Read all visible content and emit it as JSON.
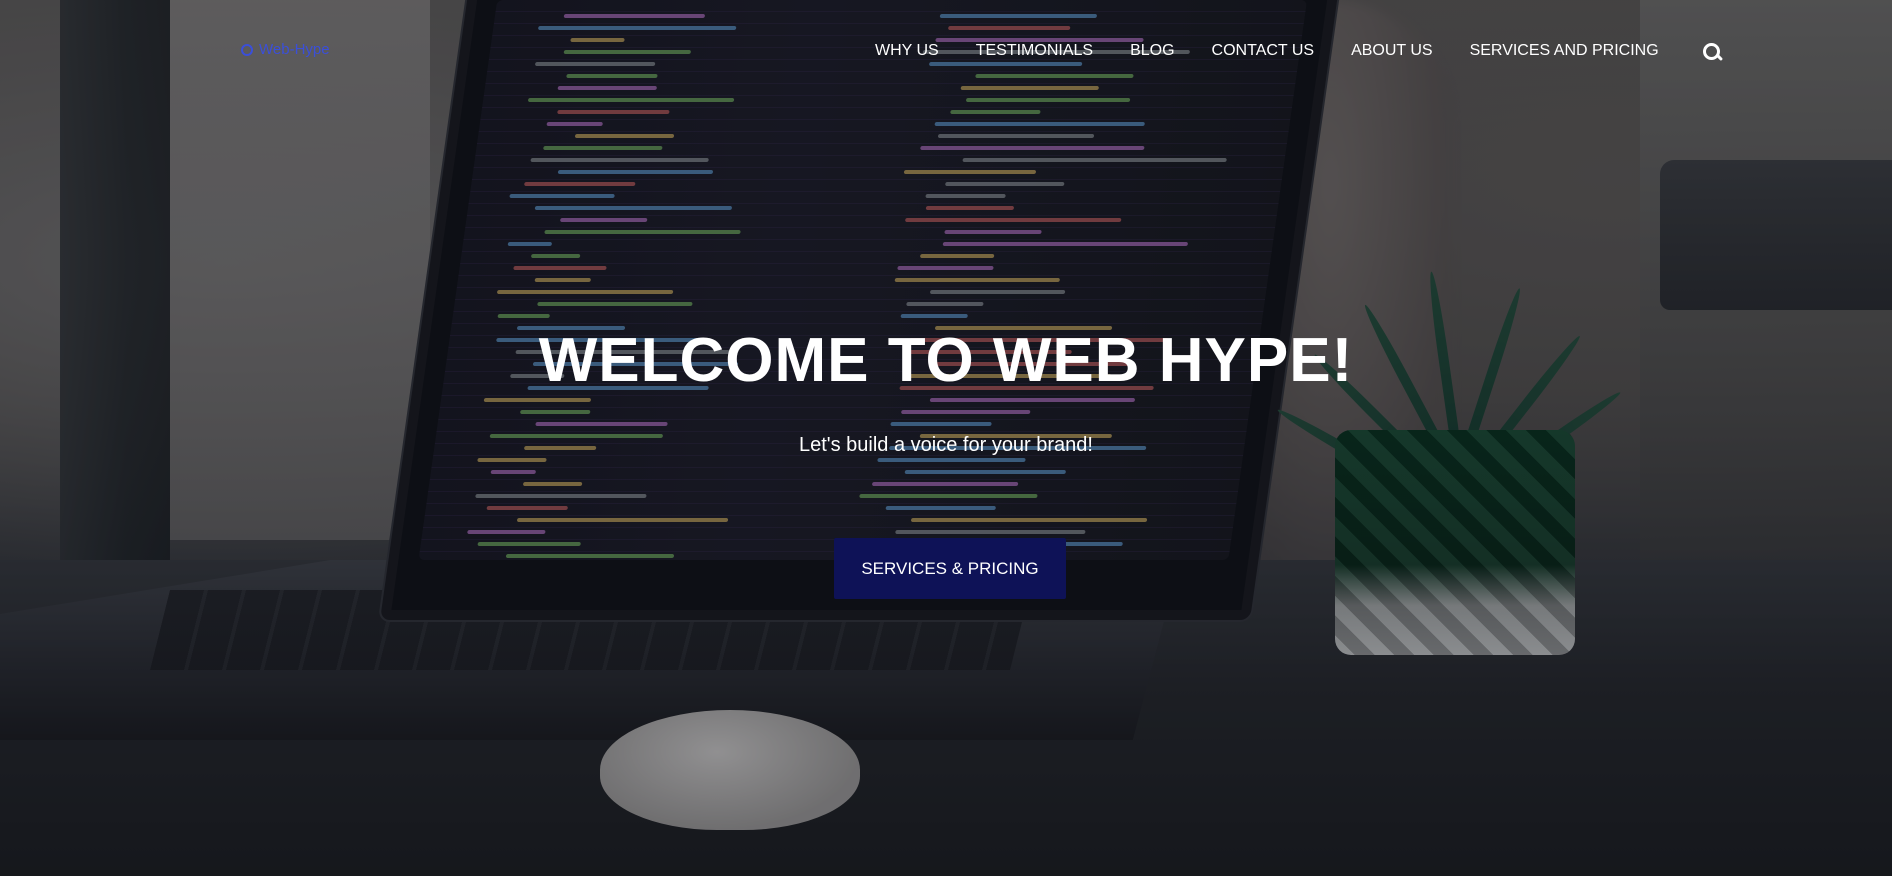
{
  "brand": {
    "logo_text": "Web-Hype",
    "logo_color": "#3b4fd8"
  },
  "nav": {
    "items": [
      {
        "label": "WHY US"
      },
      {
        "label": "TESTIMONIALS"
      },
      {
        "label": "BLOG"
      },
      {
        "label": "CONTACT US"
      },
      {
        "label": "ABOUT US"
      },
      {
        "label": "SERVICES AND PRICING"
      }
    ],
    "search_icon": "search-icon"
  },
  "hero": {
    "title": "WELCOME TO WEB HYPE!",
    "subtitle": "Let's build a voice for your brand!",
    "cta_label": "SERVICES & PRICING",
    "cta_color": "#0e1257",
    "background_image": "laptop with code on desk next to a succulent plant"
  }
}
